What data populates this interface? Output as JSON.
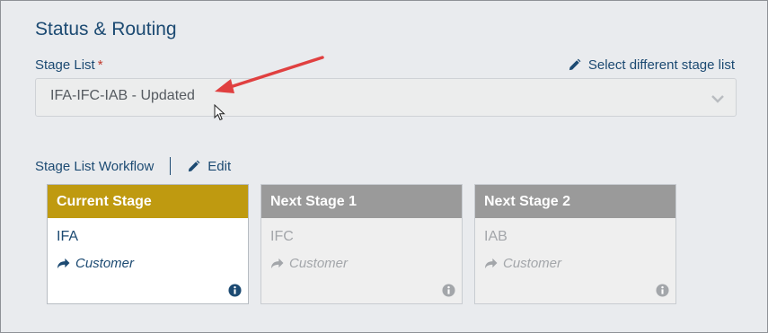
{
  "section": {
    "title": "Status & Routing"
  },
  "stage_list": {
    "label": "Stage List",
    "required_mark": "*",
    "select_link": "Select different stage list",
    "value": "IFA-IFC-IAB - Updated"
  },
  "workflow": {
    "label": "Stage List Workflow",
    "edit_label": "Edit"
  },
  "cards": [
    {
      "header": "Current Stage",
      "stage": "IFA",
      "role": "Customer"
    },
    {
      "header": "Next Stage 1",
      "stage": "IFC",
      "role": "Customer"
    },
    {
      "header": "Next Stage 2",
      "stage": "IAB",
      "role": "Customer"
    }
  ],
  "colors": {
    "primary_text": "#1c4a72",
    "current_stage": "#bf9a10",
    "next_stage": "#9a9a9a",
    "annotation_arrow": "#e04040",
    "required": "#c0392b"
  }
}
